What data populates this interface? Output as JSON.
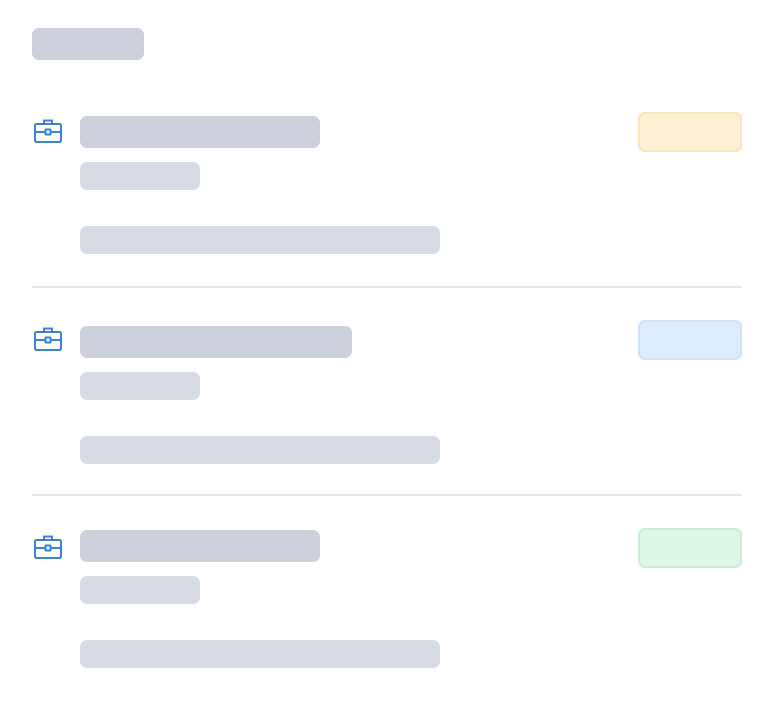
{
  "page": {
    "state": "loading"
  },
  "colors": {
    "skeleton_dark": "#cbd0da",
    "skeleton_light": "#d8dce4",
    "icon": "#3b82d6",
    "divider": "#e4e6eb"
  },
  "jobs": [
    {
      "icon": "briefcase-icon",
      "badge": {
        "tone": "amber",
        "fill": "#fff1d6",
        "border": "#fbe4b9"
      }
    },
    {
      "icon": "briefcase-icon",
      "badge": {
        "tone": "blue",
        "fill": "#deedfd",
        "border": "#cfe2f8"
      }
    },
    {
      "icon": "briefcase-icon",
      "badge": {
        "tone": "green",
        "fill": "#dcf8e4",
        "border": "#c8efd3"
      }
    }
  ]
}
